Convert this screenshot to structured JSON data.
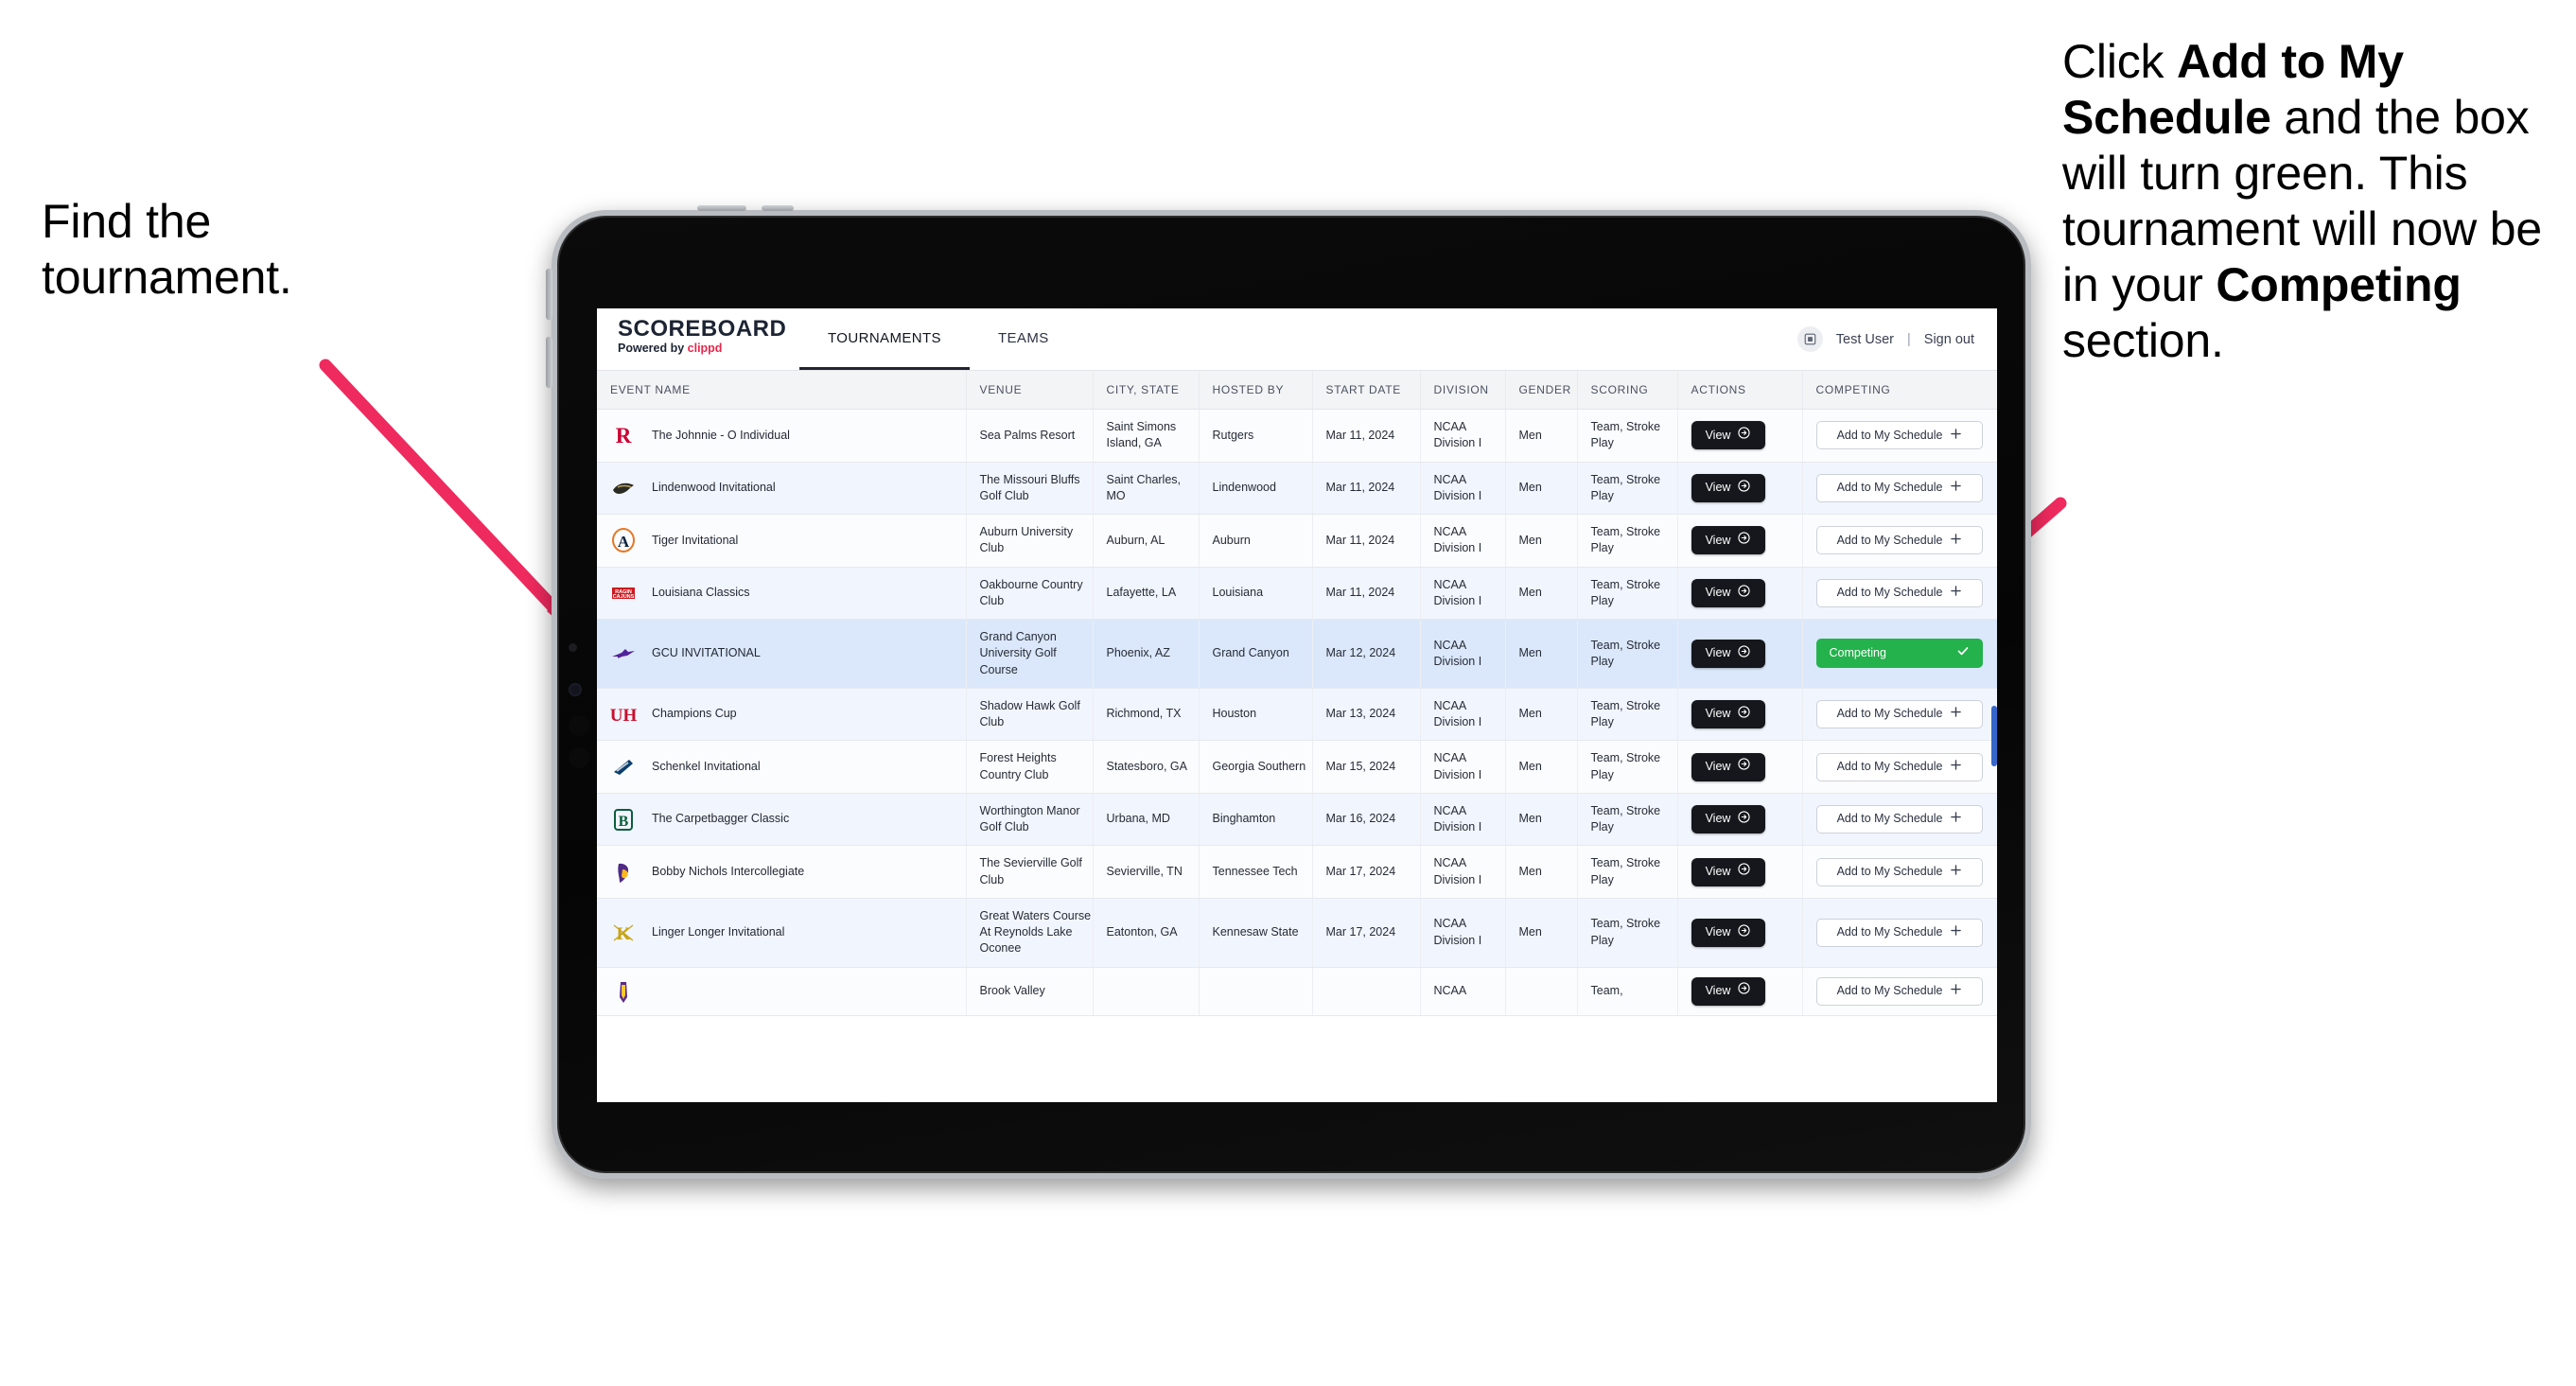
{
  "annotations": {
    "left": {
      "line1": "Find the",
      "line2": "tournament."
    },
    "right": {
      "p1_a": "Click ",
      "p1_b": "Add to My Schedule",
      "p1_c": " and the box will turn green. This tournament will now be in your ",
      "p1_d": "Competing",
      "p1_e": " section."
    },
    "arrow_color": "#ee2a5e"
  },
  "app": {
    "brand": {
      "title": "SCOREBOARD",
      "powered_prefix": "Powered by ",
      "powered_name": "clippd"
    },
    "tabs": [
      {
        "label": "TOURNAMENTS",
        "active": true
      },
      {
        "label": "TEAMS",
        "active": false
      }
    ],
    "user": {
      "name": "Test User",
      "separator": "|",
      "sign_out": "Sign out",
      "avatar_icon": "user-avatar-icon"
    },
    "table": {
      "columns": [
        "EVENT NAME",
        "VENUE",
        "CITY, STATE",
        "HOSTED BY",
        "START DATE",
        "DIVISION",
        "GENDER",
        "SCORING",
        "ACTIONS",
        "COMPETING"
      ],
      "action_label": "View",
      "add_label": "Add to My Schedule",
      "add_icon": "plus-icon",
      "competing_label": "Competing",
      "competing_icon": "check-icon",
      "competing_color": "#24b24c",
      "rows": [
        {
          "logo": "rutgers-logo",
          "name": "The Johnnie - O Individual",
          "venue": "Sea Palms Resort",
          "city": "Saint Simons Island, GA",
          "host": "Rutgers",
          "date": "Mar 11, 2024",
          "division": "NCAA Division I",
          "gender": "Men",
          "scoring": "Team, Stroke Play",
          "competing": false
        },
        {
          "logo": "lindenwood-logo",
          "name": "Lindenwood Invitational",
          "venue": "The Missouri Bluffs Golf Club",
          "city": "Saint Charles, MO",
          "host": "Lindenwood",
          "date": "Mar 11, 2024",
          "division": "NCAA Division I",
          "gender": "Men",
          "scoring": "Team, Stroke Play",
          "competing": false
        },
        {
          "logo": "auburn-logo",
          "name": "Tiger Invitational",
          "venue": "Auburn University Club",
          "city": "Auburn, AL",
          "host": "Auburn",
          "date": "Mar 11, 2024",
          "division": "NCAA Division I",
          "gender": "Men",
          "scoring": "Team, Stroke Play",
          "competing": false
        },
        {
          "logo": "louisiana-logo",
          "name": "Louisiana Classics",
          "venue": "Oakbourne Country Club",
          "city": "Lafayette, LA",
          "host": "Louisiana",
          "date": "Mar 11, 2024",
          "division": "NCAA Division I",
          "gender": "Men",
          "scoring": "Team, Stroke Play",
          "competing": false
        },
        {
          "logo": "gcu-logo",
          "name": "GCU INVITATIONAL",
          "venue": "Grand Canyon University Golf Course",
          "city": "Phoenix, AZ",
          "host": "Grand Canyon",
          "date": "Mar 12, 2024",
          "division": "NCAA Division I",
          "gender": "Men",
          "scoring": "Team, Stroke Play",
          "competing": true
        },
        {
          "logo": "houston-logo",
          "name": "Champions Cup",
          "venue": "Shadow Hawk Golf Club",
          "city": "Richmond, TX",
          "host": "Houston",
          "date": "Mar 13, 2024",
          "division": "NCAA Division I",
          "gender": "Men",
          "scoring": "Team, Stroke Play",
          "competing": false
        },
        {
          "logo": "georgia-southern-logo",
          "name": "Schenkel Invitational",
          "venue": "Forest Heights Country Club",
          "city": "Statesboro, GA",
          "host": "Georgia Southern",
          "date": "Mar 15, 2024",
          "division": "NCAA Division I",
          "gender": "Men",
          "scoring": "Team, Stroke Play",
          "competing": false
        },
        {
          "logo": "binghamton-logo",
          "name": "The Carpetbagger Classic",
          "venue": "Worthington Manor Golf Club",
          "city": "Urbana, MD",
          "host": "Binghamton",
          "date": "Mar 16, 2024",
          "division": "NCAA Division I",
          "gender": "Men",
          "scoring": "Team, Stroke Play",
          "competing": false
        },
        {
          "logo": "tennessee-tech-logo",
          "name": "Bobby Nichols Intercollegiate",
          "venue": "The Sevierville Golf Club",
          "city": "Sevierville, TN",
          "host": "Tennessee Tech",
          "date": "Mar 17, 2024",
          "division": "NCAA Division I",
          "gender": "Men",
          "scoring": "Team, Stroke Play",
          "competing": false
        },
        {
          "logo": "kennesaw-logo",
          "name": "Linger Longer Invitational",
          "venue": "Great Waters Course At Reynolds Lake Oconee",
          "city": "Eatonton, GA",
          "host": "Kennesaw State",
          "date": "Mar 17, 2024",
          "division": "NCAA Division I",
          "gender": "Men",
          "scoring": "Team, Stroke Play",
          "competing": false
        },
        {
          "logo": "east-carolina-logo",
          "name": "",
          "venue": "Brook Valley",
          "city": "",
          "host": "",
          "date": "",
          "division": "NCAA",
          "gender": "",
          "scoring": "Team,",
          "competing": false
        }
      ]
    }
  }
}
